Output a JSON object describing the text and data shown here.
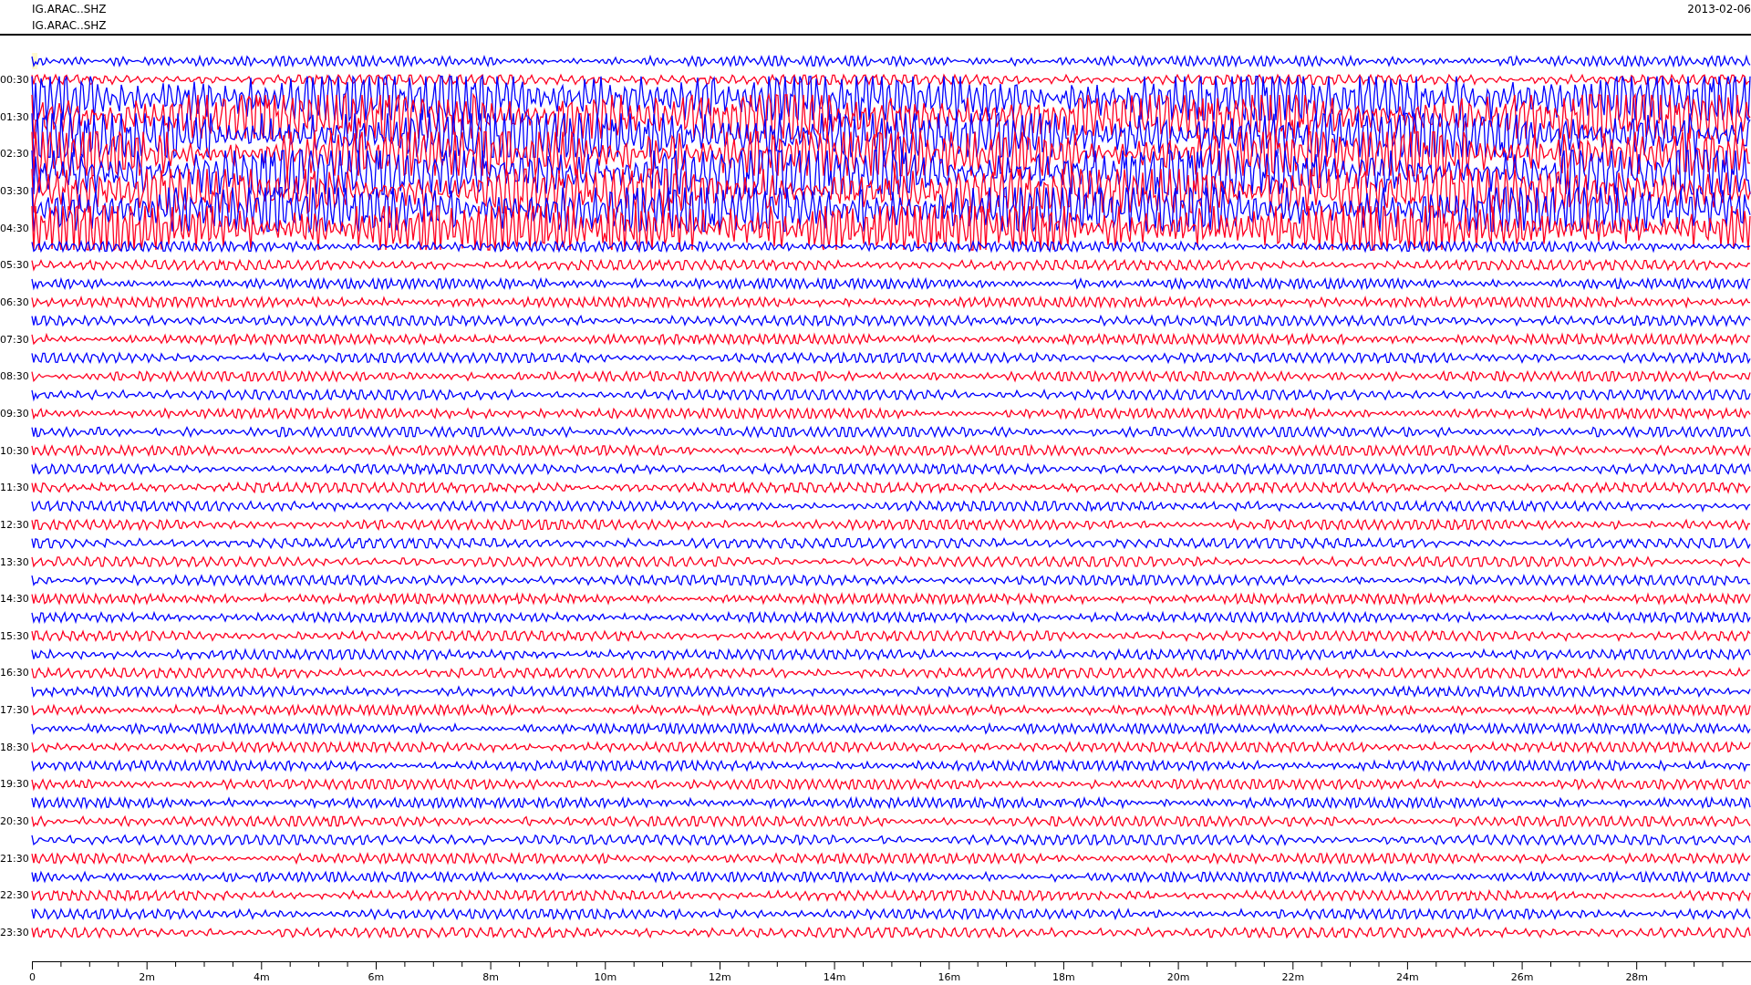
{
  "header": {
    "channel_lines": [
      "IG.ARAC..SHZ",
      "IG.ARAC..SHZ"
    ],
    "date": "2013-02-06"
  },
  "traces": [
    {
      "color": "#0000ff",
      "kind": "quiet"
    },
    {
      "color": "#ff0022",
      "kind": "quiet",
      "time_label": "00:30"
    },
    {
      "color": "#0000ff",
      "kind": "burst"
    },
    {
      "color": "#ff0022",
      "kind": "burst",
      "time_label": "01:30"
    },
    {
      "color": "#0000ff",
      "kind": "burst"
    },
    {
      "color": "#ff0022",
      "kind": "burst",
      "time_label": "02:30"
    },
    {
      "color": "#0000ff",
      "kind": "burst"
    },
    {
      "color": "#ff0022",
      "kind": "burst",
      "time_label": "03:30"
    },
    {
      "color": "#0000ff",
      "kind": "burst"
    },
    {
      "color": "#ff0022",
      "kind": "burst",
      "time_label": "04:30"
    },
    {
      "color": "#0000ff",
      "kind": "quiet"
    },
    {
      "color": "#ff0022",
      "kind": "quiet",
      "time_label": "05:30"
    },
    {
      "color": "#0000ff",
      "kind": "quiet"
    },
    {
      "color": "#ff0022",
      "kind": "quiet",
      "time_label": "06:30"
    },
    {
      "color": "#0000ff",
      "kind": "quiet"
    },
    {
      "color": "#ff0022",
      "kind": "quiet",
      "time_label": "07:30"
    },
    {
      "color": "#0000ff",
      "kind": "quiet"
    },
    {
      "color": "#ff0022",
      "kind": "quiet",
      "time_label": "08:30"
    },
    {
      "color": "#0000ff",
      "kind": "quiet"
    },
    {
      "color": "#ff0022",
      "kind": "quiet",
      "time_label": "09:30"
    },
    {
      "color": "#0000ff",
      "kind": "quiet"
    },
    {
      "color": "#ff0022",
      "kind": "quiet",
      "time_label": "10:30"
    },
    {
      "color": "#0000ff",
      "kind": "quiet"
    },
    {
      "color": "#ff0022",
      "kind": "quiet",
      "time_label": "11:30"
    },
    {
      "color": "#0000ff",
      "kind": "quiet"
    },
    {
      "color": "#ff0022",
      "kind": "quiet",
      "time_label": "12:30"
    },
    {
      "color": "#0000ff",
      "kind": "quiet"
    },
    {
      "color": "#ff0022",
      "kind": "quiet",
      "time_label": "13:30"
    },
    {
      "color": "#0000ff",
      "kind": "quiet"
    },
    {
      "color": "#ff0022",
      "kind": "quiet",
      "time_label": "14:30"
    },
    {
      "color": "#0000ff",
      "kind": "quiet"
    },
    {
      "color": "#ff0022",
      "kind": "quiet",
      "time_label": "15:30"
    },
    {
      "color": "#0000ff",
      "kind": "quiet"
    },
    {
      "color": "#ff0022",
      "kind": "quiet",
      "time_label": "16:30"
    },
    {
      "color": "#0000ff",
      "kind": "quiet"
    },
    {
      "color": "#ff0022",
      "kind": "quiet",
      "time_label": "17:30"
    },
    {
      "color": "#0000ff",
      "kind": "quiet"
    },
    {
      "color": "#ff0022",
      "kind": "quiet",
      "time_label": "18:30"
    },
    {
      "color": "#0000ff",
      "kind": "quiet"
    },
    {
      "color": "#ff0022",
      "kind": "quiet",
      "time_label": "19:30"
    },
    {
      "color": "#0000ff",
      "kind": "quiet"
    },
    {
      "color": "#ff0022",
      "kind": "quiet",
      "time_label": "20:30"
    },
    {
      "color": "#0000ff",
      "kind": "quiet"
    },
    {
      "color": "#ff0022",
      "kind": "quiet",
      "time_label": "21:30"
    },
    {
      "color": "#0000ff",
      "kind": "quiet"
    },
    {
      "color": "#ff0022",
      "kind": "quiet",
      "time_label": "22:30"
    },
    {
      "color": "#0000ff",
      "kind": "quiet"
    },
    {
      "color": "#ff0022",
      "kind": "quiet",
      "time_label": "23:30"
    }
  ],
  "x_axis": {
    "tick_labels": [
      "0",
      "2m",
      "4m",
      "6m",
      "8m",
      "10m",
      "12m",
      "14m",
      "16m",
      "18m",
      "20m",
      "22m",
      "24m",
      "26m",
      "28m"
    ]
  }
}
